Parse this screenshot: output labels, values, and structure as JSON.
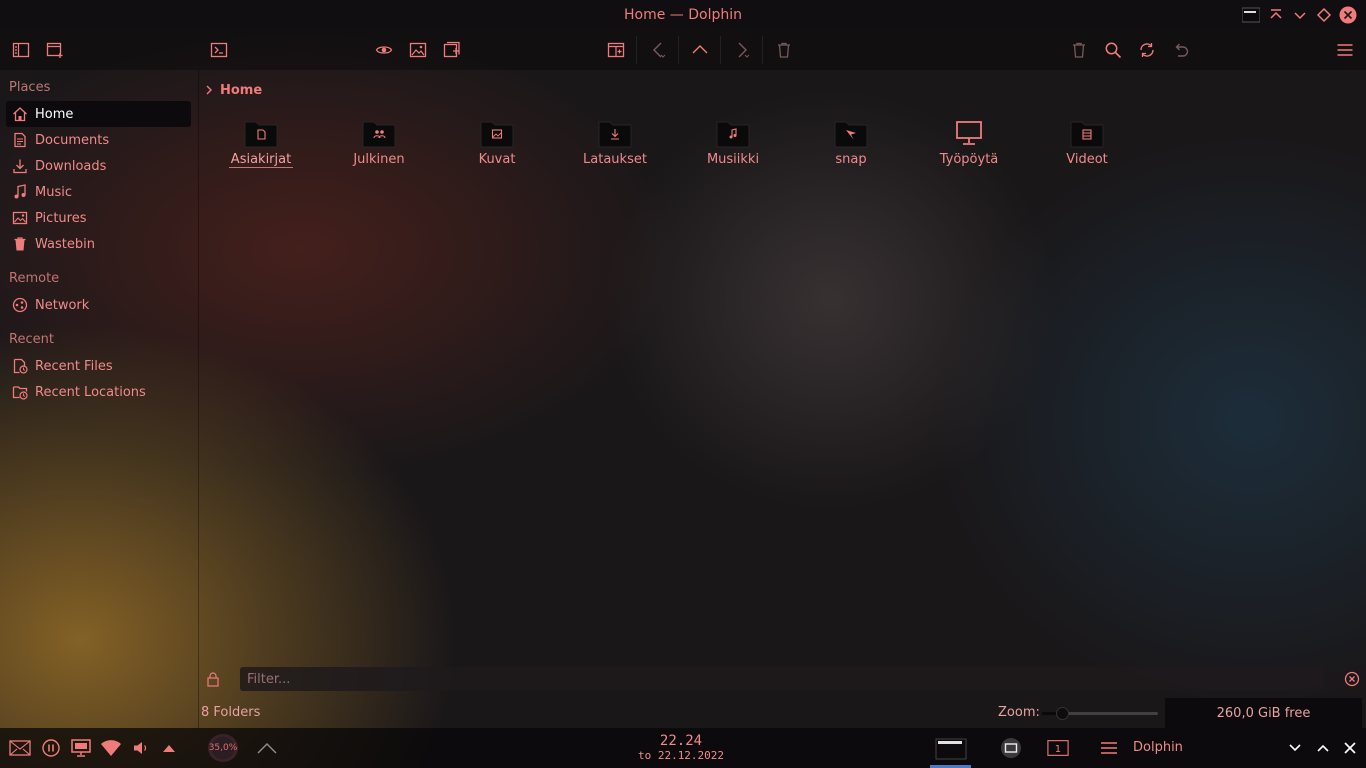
{
  "window": {
    "title": "Home — Dolphin"
  },
  "sidebar": {
    "sections": [
      {
        "title": "Places",
        "items": [
          {
            "label": "Home",
            "icon": "home-icon",
            "active": true
          },
          {
            "label": "Documents",
            "icon": "documents-icon"
          },
          {
            "label": "Downloads",
            "icon": "downloads-icon"
          },
          {
            "label": "Music",
            "icon": "music-icon"
          },
          {
            "label": "Pictures",
            "icon": "pictures-icon"
          },
          {
            "label": "Wastebin",
            "icon": "wastebin-icon"
          }
        ]
      },
      {
        "title": "Remote",
        "items": [
          {
            "label": "Network",
            "icon": "network-icon"
          }
        ]
      },
      {
        "title": "Recent",
        "items": [
          {
            "label": "Recent Files",
            "icon": "recent-files-icon"
          },
          {
            "label": "Recent Locations",
            "icon": "recent-locations-icon"
          }
        ]
      }
    ]
  },
  "breadcrumb": {
    "current": "Home"
  },
  "folders": [
    {
      "label": "Asiakirjat",
      "icon": "documents-folder-icon",
      "selected": true
    },
    {
      "label": "Julkinen",
      "icon": "public-folder-icon"
    },
    {
      "label": "Kuvat",
      "icon": "pictures-folder-icon"
    },
    {
      "label": "Lataukset",
      "icon": "downloads-folder-icon"
    },
    {
      "label": "Musiikki",
      "icon": "music-folder-icon"
    },
    {
      "label": "snap",
      "icon": "snap-folder-icon"
    },
    {
      "label": "Työpöytä",
      "icon": "desktop-icon"
    },
    {
      "label": "Videot",
      "icon": "videos-folder-icon"
    }
  ],
  "filter": {
    "placeholder": "Filter..."
  },
  "status": {
    "folder_count": "8 Folders",
    "zoom_label": "Zoom:",
    "zoom_level": 0.18,
    "free_space": "260,0 GiB free"
  },
  "taskbar": {
    "battery": "35,0%",
    "time": "22.24",
    "date": "to 22.12.2022",
    "pager": "1",
    "app_name": "Dolphin"
  },
  "colors": {
    "accent": "#f07b7b",
    "background": "#1a1719",
    "taskbar_highlight": "#4a7cc4"
  }
}
